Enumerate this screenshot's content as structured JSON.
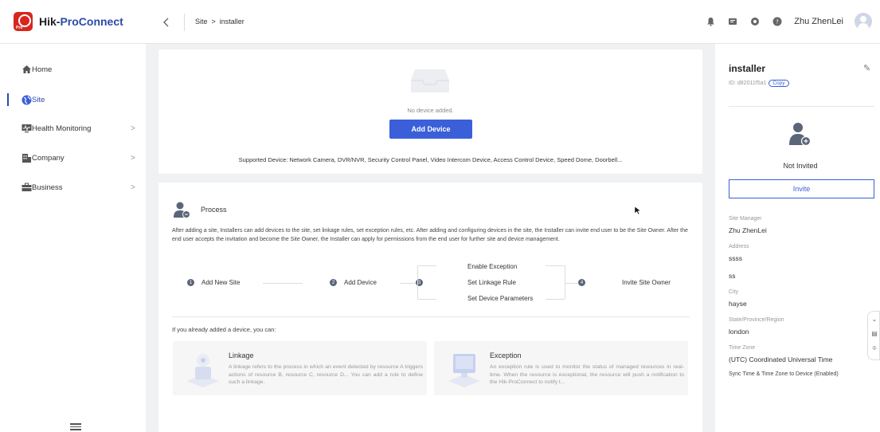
{
  "app": {
    "brand_main": "Hik-",
    "brand_accent": "ProConnect",
    "brand_badge": "Pro"
  },
  "colors": {
    "accent": "#3a5fd9",
    "brand_red": "#d7261e",
    "brand_blue": "#2c4aa8"
  },
  "breadcrumb": {
    "parent": "Site",
    "separator": ">",
    "current": "installer"
  },
  "header": {
    "user_name": "Zhu ZhenLei",
    "icons": [
      "bell-icon",
      "message-icon",
      "settings-icon",
      "help-icon"
    ]
  },
  "sidebar": {
    "items": [
      {
        "label": "Home",
        "icon": "home-icon"
      },
      {
        "label": "Site",
        "icon": "globe-icon"
      },
      {
        "label": "Health Monitoring",
        "icon": "monitor-icon"
      },
      {
        "label": "Company",
        "icon": "building-icon"
      },
      {
        "label": "Business",
        "icon": "briefcase-icon"
      }
    ]
  },
  "device": {
    "empty_text": "No device added.",
    "add_button": "Add Device",
    "supported": "Supported Device: Network Camera, DVR/NVR, Security Control Panel, Video Intercom Device, Access Control Device, Speed Dome, Doorbell..."
  },
  "process": {
    "title": "Process",
    "description": "After adding a site, Installers can add devices to the site, set linkage rules, set exception rules, etc. After adding and configuring devices in the site, the Installer can invite end user to be the Site Owner. After the end user accepts the invitation and become the Site Owner, the Installer can apply for permissions from the end user for further site and device management.",
    "steps": {
      "s1": "Add New Site",
      "s2": "Add Device",
      "s3a": "Enable Exception",
      "s3b": "Set Linkage Rule",
      "s3c": "Set Device Parameters",
      "s4": "Invite Site Owner"
    },
    "already": "If you already added a device, you can:"
  },
  "cards": {
    "linkage": {
      "title": "Linkage",
      "desc": "A linkage refers to the process in which an event detected by resource A triggers actions of resource B, resource C, resource D... You can add a rule to define such a linkage."
    },
    "exception": {
      "title": "Exception",
      "desc": "An exception rule is used to monitor the status of managed resources in real-time. When the resource is exceptional, the resource will push a notification to the Hik-ProConnect to notify t..."
    }
  },
  "panel": {
    "name": "installer",
    "id_label": "ID: d82011f5a1",
    "copy": "Copy",
    "status": "Not Invited",
    "invite": "Invite",
    "site_manager_label": "Site Manager",
    "site_manager": "Zhu ZhenLei",
    "address_label": "Address",
    "address1": "ssss",
    "address2": "ss",
    "city_label": "City",
    "city": "hayse",
    "state_label": "State/Province/Region",
    "state": "london",
    "tz_label": "Time Zone",
    "tz": "(UTC) Coordinated Universal Time",
    "sync": "Sync Time & Time Zone to Device (Enabled)"
  }
}
